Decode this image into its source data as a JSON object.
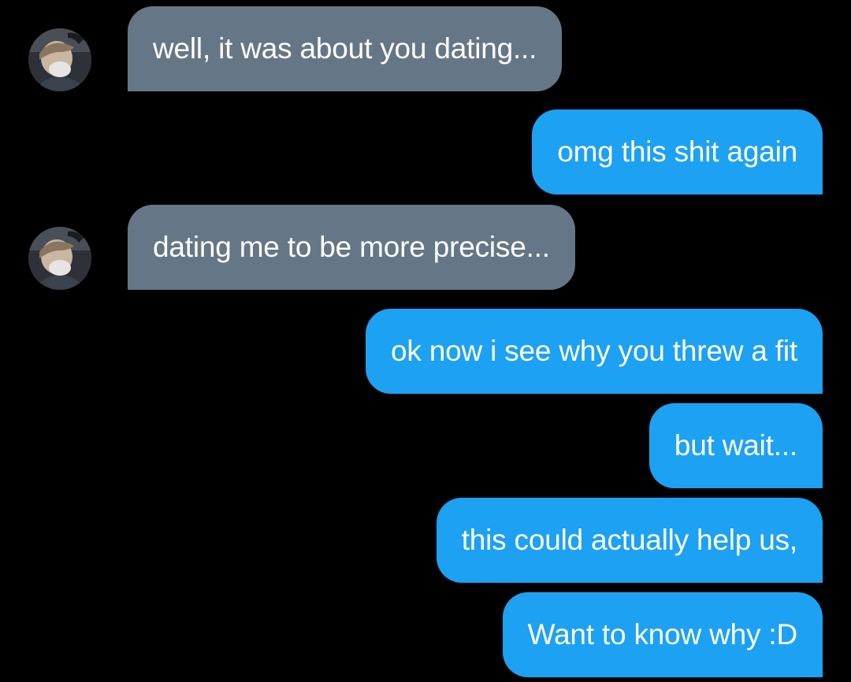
{
  "colors": {
    "background": "#000000",
    "incoming_bubble": "#657786",
    "outgoing_bubble": "#1DA1F2",
    "text": "#ffffff"
  },
  "messages": [
    {
      "direction": "incoming",
      "text": "well, it was about you dating...",
      "avatar": "contact-avatar-photo"
    },
    {
      "direction": "outgoing",
      "text": "omg this shit again"
    },
    {
      "direction": "incoming",
      "text": "dating me to be more precise...",
      "avatar": "contact-avatar-photo"
    },
    {
      "direction": "outgoing",
      "text": "ok now i see why you threw a fit"
    },
    {
      "direction": "outgoing",
      "text": "but wait..."
    },
    {
      "direction": "outgoing",
      "text": "this could actually help us,"
    },
    {
      "direction": "outgoing",
      "text": "Want to know why :D"
    }
  ]
}
